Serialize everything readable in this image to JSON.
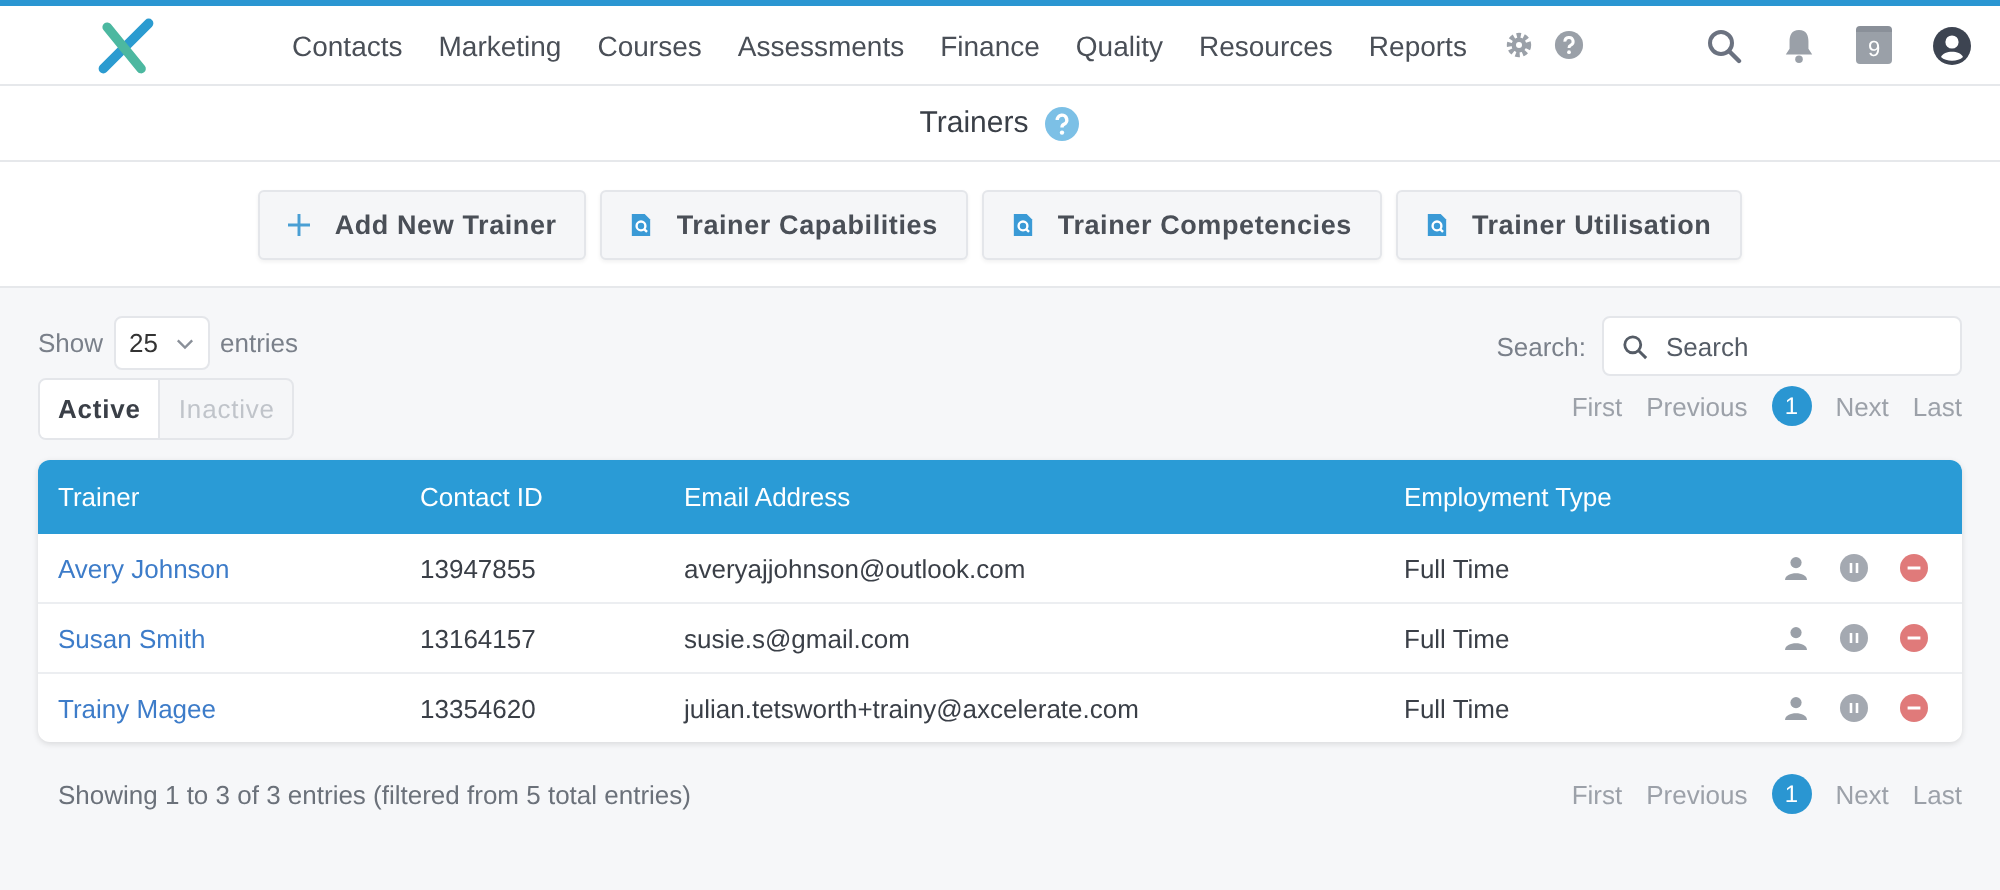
{
  "nav": {
    "items": [
      "Contacts",
      "Marketing",
      "Courses",
      "Assessments",
      "Finance",
      "Quality",
      "Resources",
      "Reports"
    ],
    "calendar_badge": "9"
  },
  "page_title": "Trainers",
  "actions": [
    {
      "kind": "add",
      "label": "Add New Trainer"
    },
    {
      "kind": "report",
      "label": "Trainer Capabilities"
    },
    {
      "kind": "report",
      "label": "Trainer Competencies"
    },
    {
      "kind": "report",
      "label": "Trainer Utilisation"
    }
  ],
  "length": {
    "before": "Show",
    "value": "25",
    "after": "entries"
  },
  "filter_tabs": [
    {
      "label": "Active",
      "selected": true
    },
    {
      "label": "Inactive",
      "selected": false
    }
  ],
  "search": {
    "label": "Search:",
    "placeholder": "Search"
  },
  "pager_top": [
    {
      "kind": "nav",
      "label": "First",
      "disabled": true
    },
    {
      "kind": "nav",
      "label": "Previous",
      "disabled": true
    },
    {
      "kind": "page",
      "label": "1",
      "selected": true
    },
    {
      "kind": "nav",
      "label": "Next",
      "disabled": true
    },
    {
      "kind": "nav",
      "label": "Last",
      "disabled": true
    }
  ],
  "pager_bottom": [
    {
      "kind": "nav",
      "label": "First",
      "disabled": true
    },
    {
      "kind": "nav",
      "label": "Previous",
      "disabled": true
    },
    {
      "kind": "page",
      "label": "1",
      "selected": true
    },
    {
      "kind": "nav",
      "label": "Next",
      "disabled": true
    },
    {
      "kind": "nav",
      "label": "Last",
      "disabled": true
    }
  ],
  "table": {
    "columns": [
      "Trainer",
      "Contact ID",
      "Email Address",
      "Employment Type"
    ],
    "rows": [
      {
        "trainer": "Avery Johnson",
        "contact_id": "13947855",
        "email": "averyajjohnson@outlook.com",
        "employment": "Full Time"
      },
      {
        "trainer": "Susan Smith",
        "contact_id": "13164157",
        "email": "susie.s@gmail.com",
        "employment": "Full Time"
      },
      {
        "trainer": "Trainy Magee",
        "contact_id": "13354620",
        "email": "julian.tetsworth+trainy@axcelerate.com",
        "employment": "Full Time"
      }
    ]
  },
  "info": "Showing 1 to 3 of 3 entries (filtered from 5 total entries)"
}
